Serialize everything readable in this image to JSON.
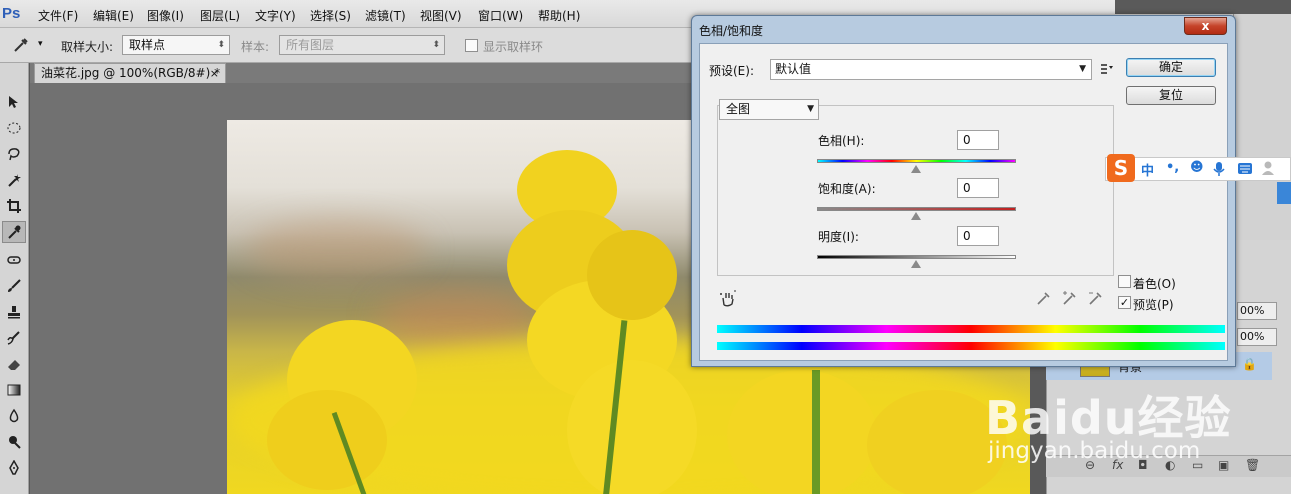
{
  "menubar": {
    "logo": "Ps",
    "items": [
      "文件(F)",
      "编辑(E)",
      "图像(I)",
      "图层(L)",
      "文字(Y)",
      "选择(S)",
      "滤镜(T)",
      "视图(V)",
      "窗口(W)",
      "帮助(H)"
    ]
  },
  "options": {
    "sample_size_label": "取样大小:",
    "sample_size_value": "取样点",
    "sample_label": "样本:",
    "sample_value": "所有图层",
    "show_ring_label": "显示取样环"
  },
  "document": {
    "tab_title": "油菜花.jpg @ 100%(RGB/8#) *",
    "close": "×"
  },
  "dialog": {
    "title": "色相/饱和度",
    "close": "x",
    "preset_label": "预设(E):",
    "preset_value": "默认值",
    "ok_button": "确定",
    "reset_button": "复位",
    "edit_value": "全图",
    "hue_label": "色相(H):",
    "hue_value": "0",
    "saturation_label": "饱和度(A):",
    "saturation_value": "0",
    "lightness_label": "明度(I):",
    "lightness_value": "0",
    "colorize_label": "着色(O)",
    "colorize_checked": false,
    "preview_label": "预览(P)",
    "preview_checked": true
  },
  "layers": {
    "layer_name": "背景",
    "opacity_1": "00%",
    "opacity_2": "00%"
  },
  "ime": {
    "logo": "S",
    "mode": "中",
    "punct": "•,"
  },
  "watermark": {
    "main": "Baidu经验",
    "sub": "jingyan.baidu.com"
  }
}
